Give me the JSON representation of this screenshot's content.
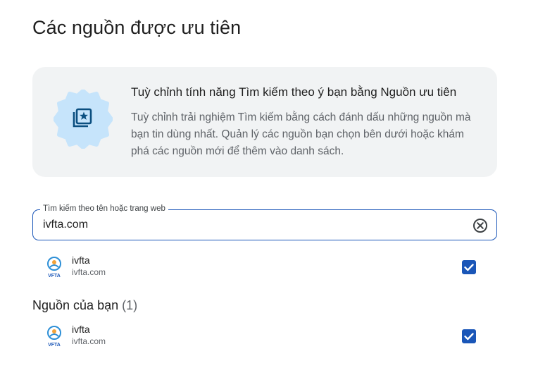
{
  "page": {
    "title": "Các nguồn được ưu tiên"
  },
  "info_card": {
    "icon": "star-bookmark-icon",
    "title": "Tuỳ chỉnh tính năng Tìm kiếm theo ý bạn bằng Nguồn ưu tiên",
    "body": "Tuỳ chỉnh trải nghiệm Tìm kiếm bằng cách đánh dấu những nguồn mà bạn tin dùng nhất. Quản lý các nguồn bạn chọn bên dưới hoặc khám phá các nguồn mới để thêm vào danh sách."
  },
  "search": {
    "label": "Tìm kiếm theo tên hoặc trang web",
    "value": "ivfta.com",
    "clear_icon": "clear-circle-icon"
  },
  "search_results": [
    {
      "name": "ivfta",
      "domain": "ivfta.com",
      "logo_text": "VFTA",
      "checked": true
    }
  ],
  "your_sources": {
    "heading": "Nguồn của bạn",
    "count": "(1)",
    "items": [
      {
        "name": "ivfta",
        "domain": "ivfta.com",
        "logo_text": "VFTA",
        "checked": true
      }
    ]
  },
  "colors": {
    "accent": "#1a56b8",
    "card_bg": "#f1f3f4",
    "badge_bg": "#c6e4fb",
    "badge_icon": "#0b4f80"
  }
}
